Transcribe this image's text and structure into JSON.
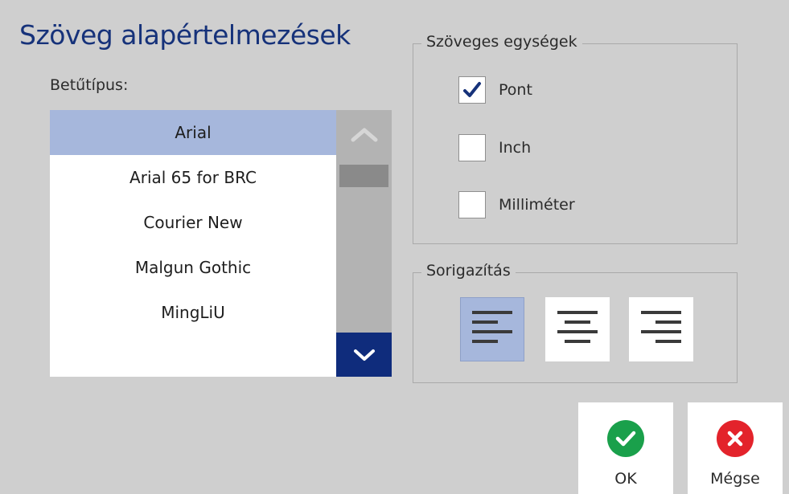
{
  "dialog": {
    "title": "Szöveg alapértelmezések"
  },
  "font_picker": {
    "label": "Betűtípus:",
    "items": [
      {
        "label": "Arial",
        "selected": true
      },
      {
        "label": "Arial 65 for BRC",
        "selected": false
      },
      {
        "label": "Courier New",
        "selected": false
      },
      {
        "label": "Malgun Gothic",
        "selected": false
      },
      {
        "label": "MingLiU",
        "selected": false
      }
    ]
  },
  "text_units": {
    "legend": "Szöveges egységek",
    "options": [
      {
        "label": "Pont",
        "checked": true
      },
      {
        "label": "Inch",
        "checked": false
      },
      {
        "label": "Milliméter",
        "checked": false
      }
    ]
  },
  "alignment": {
    "legend": "Sorigazítás",
    "options": [
      {
        "name": "align-left-icon",
        "selected": true
      },
      {
        "name": "align-center-icon",
        "selected": false
      },
      {
        "name": "align-right-icon",
        "selected": false
      }
    ]
  },
  "actions": {
    "ok_label": "OK",
    "cancel_label": "Mégse"
  },
  "colors": {
    "title": "#16327a",
    "selection": "#a6b7dc",
    "scroll_down_bg": "#0f2c7c",
    "ok_green": "#1aa04b",
    "cancel_red": "#e3232b",
    "checkmark": "#16327a"
  }
}
